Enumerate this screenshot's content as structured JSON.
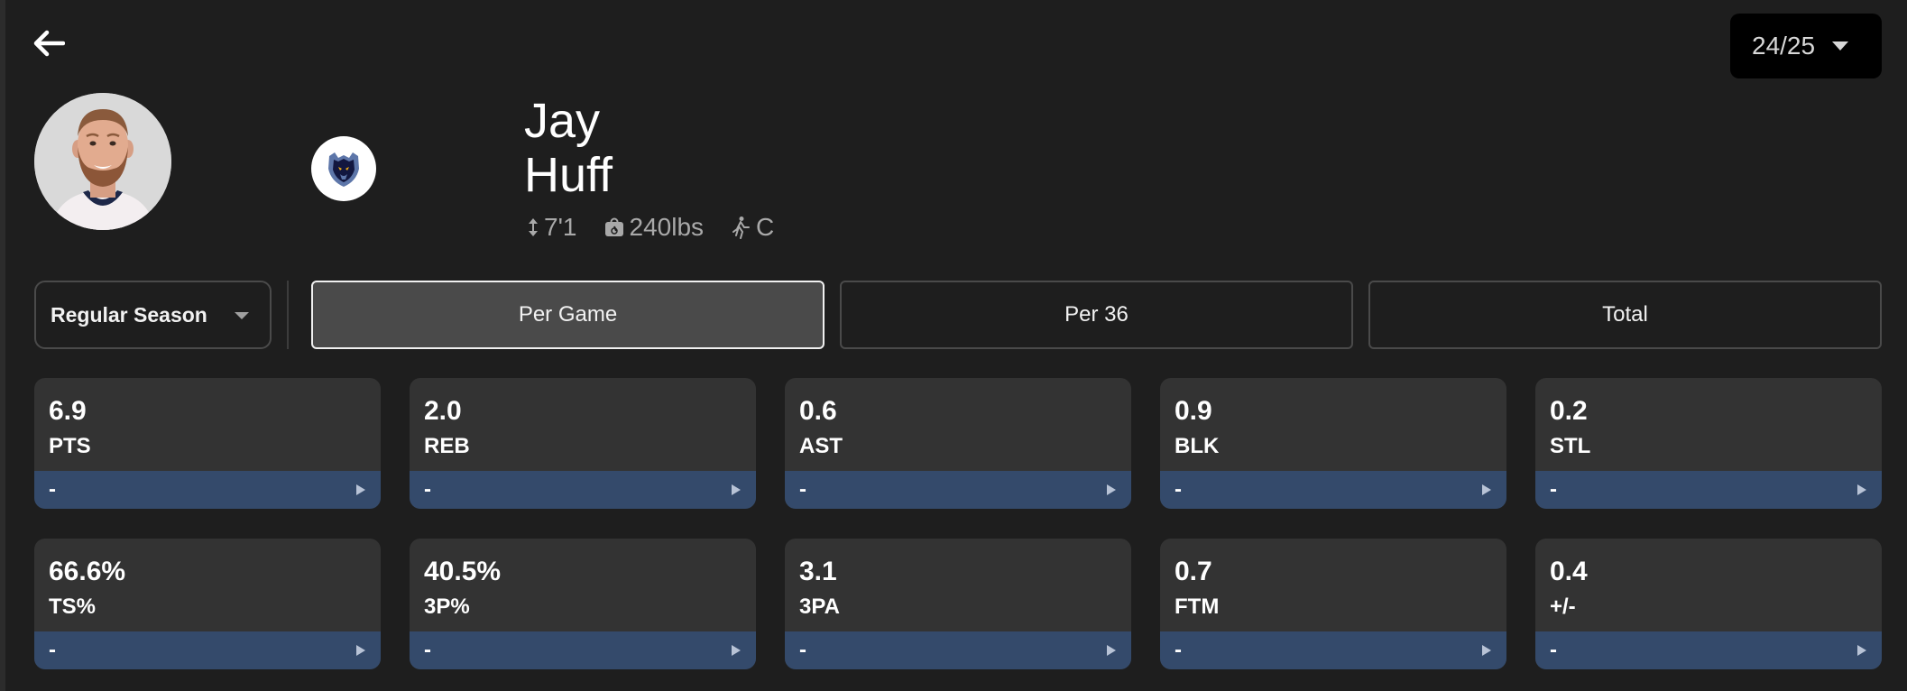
{
  "header": {
    "back_icon": "arrow-left-icon",
    "season": "24/25"
  },
  "player": {
    "first_name": "Jay",
    "last_name": "Huff",
    "height": "7'1",
    "weight": "240lbs",
    "position": "C"
  },
  "filters": {
    "season_type": "Regular Season",
    "tabs": [
      {
        "label": "Per Game",
        "active": true
      },
      {
        "label": "Per 36",
        "active": false
      },
      {
        "label": "Total",
        "active": false
      }
    ]
  },
  "stats": [
    {
      "value": "6.9",
      "label": "PTS",
      "rank": "-"
    },
    {
      "value": "2.0",
      "label": "REB",
      "rank": "-"
    },
    {
      "value": "0.6",
      "label": "AST",
      "rank": "-"
    },
    {
      "value": "0.9",
      "label": "BLK",
      "rank": "-"
    },
    {
      "value": "0.2",
      "label": "STL",
      "rank": "-"
    },
    {
      "value": "66.6%",
      "label": "TS%",
      "rank": "-"
    },
    {
      "value": "40.5%",
      "label": "3P%",
      "rank": "-"
    },
    {
      "value": "3.1",
      "label": "3PA",
      "rank": "-"
    },
    {
      "value": "0.7",
      "label": "FTM",
      "rank": "-"
    },
    {
      "value": "0.4",
      "label": "+/-",
      "rank": "-"
    }
  ],
  "colors": {
    "background": "#1e1e1e",
    "card": "#333333",
    "card_bar": "#344a6b",
    "active_tab": "#4a4a4a"
  }
}
